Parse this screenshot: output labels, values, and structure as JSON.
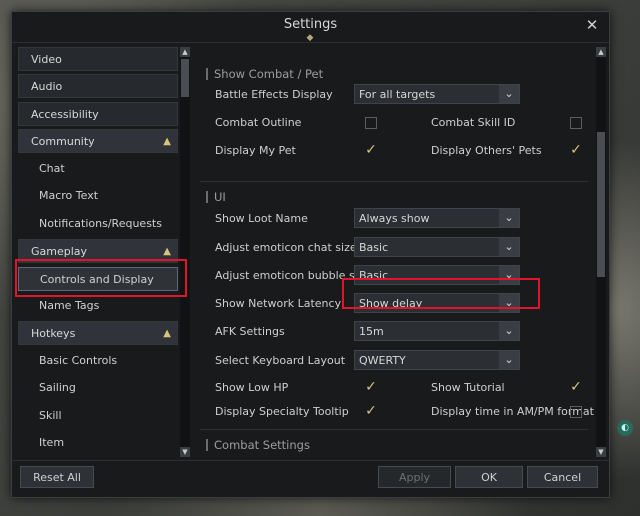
{
  "window": {
    "title": "Settings"
  },
  "sidebar": {
    "items": [
      {
        "label": "Video",
        "type": "item"
      },
      {
        "label": "Audio",
        "type": "item"
      },
      {
        "label": "Accessibility",
        "type": "item"
      },
      {
        "label": "Community",
        "type": "category"
      },
      {
        "label": "Chat",
        "type": "sub"
      },
      {
        "label": "Macro Text",
        "type": "sub"
      },
      {
        "label": "Notifications/Requests",
        "type": "sub"
      },
      {
        "label": "Gameplay",
        "type": "category"
      },
      {
        "label": "Controls and Display",
        "type": "sub",
        "selected": true
      },
      {
        "label": "Name Tags",
        "type": "sub"
      },
      {
        "label": "Hotkeys",
        "type": "category"
      },
      {
        "label": "Basic Controls",
        "type": "sub"
      },
      {
        "label": "Sailing",
        "type": "sub"
      },
      {
        "label": "Skill",
        "type": "sub"
      },
      {
        "label": "Item",
        "type": "sub"
      }
    ]
  },
  "sections": {
    "combat_pet": "Show Combat / Pet",
    "ui": "UI",
    "combat_settings": "Combat Settings"
  },
  "settings": {
    "battle_effects_display": {
      "label": "Battle Effects Display",
      "value": "For all targets"
    },
    "combat_outline": {
      "label": "Combat Outline",
      "checked": false
    },
    "combat_skill_id": {
      "label": "Combat Skill ID",
      "checked": false
    },
    "display_my_pet": {
      "label": "Display My Pet",
      "checked": true
    },
    "display_others_pets": {
      "label": "Display Others' Pets",
      "checked": true
    },
    "show_loot_name": {
      "label": "Show Loot Name",
      "value": "Always show"
    },
    "emoticon_chat_size": {
      "label": "Adjust emoticon chat size",
      "value": "Basic"
    },
    "emoticon_bubble_size": {
      "label": "Adjust emoticon bubble size",
      "value": "Basic"
    },
    "show_network_latency": {
      "label": "Show Network Latency",
      "value": "Show delay"
    },
    "afk_settings": {
      "label": "AFK Settings",
      "value": "15m"
    },
    "keyboard_layout": {
      "label": "Select Keyboard Layout",
      "value": "QWERTY"
    },
    "show_low_hp": {
      "label": "Show Low HP",
      "checked": true
    },
    "show_tutorial": {
      "label": "Show Tutorial",
      "checked": true
    },
    "specialty_tooltip": {
      "label": "Display Specialty Tooltip",
      "checked": true
    },
    "time_ampm": {
      "label": "Display time in AM/PM format",
      "checked": false
    }
  },
  "footer": {
    "reset_all": "Reset All",
    "apply": "Apply",
    "ok": "OK",
    "cancel": "Cancel"
  },
  "colors": {
    "highlight": "#e0152a",
    "accent": "#d9c27a"
  }
}
